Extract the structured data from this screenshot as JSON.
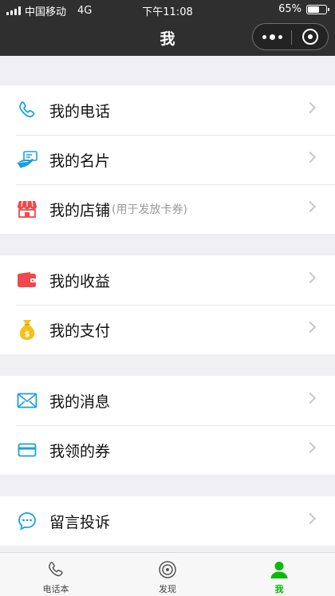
{
  "status_bar": {
    "carrier": "中国移动",
    "network": "4G",
    "time": "下午11:08",
    "battery": "65%",
    "battery_level": 0.65
  },
  "nav": {
    "title": "我"
  },
  "menu": {
    "group1": [
      {
        "label": "我的电话",
        "hint": "",
        "icon": "phone-icon"
      },
      {
        "label": "我的名片",
        "hint": "",
        "icon": "business-card-icon"
      },
      {
        "label": "我的店铺",
        "hint": "(用于发放卡券)",
        "icon": "store-icon"
      }
    ],
    "group2": [
      {
        "label": "我的收益",
        "hint": "",
        "icon": "wallet-icon"
      },
      {
        "label": "我的支付",
        "hint": "",
        "icon": "money-bag-icon"
      }
    ],
    "group3": [
      {
        "label": "我的消息",
        "hint": "",
        "icon": "envelope-icon"
      },
      {
        "label": "我领的券",
        "hint": "",
        "icon": "coupon-card-icon"
      }
    ],
    "group4": [
      {
        "label": "留言投诉",
        "hint": "",
        "icon": "chat-bubble-icon"
      }
    ]
  },
  "tabs": [
    {
      "label": "电话本",
      "icon": "phone-icon",
      "active": false
    },
    {
      "label": "发现",
      "icon": "compass-icon",
      "active": false
    },
    {
      "label": "我",
      "icon": "user-icon",
      "active": true
    }
  ],
  "colors": {
    "accent": "#09bb07",
    "icon_blue": "#1aa0dc",
    "icon_red": "#f0484b",
    "icon_yellow": "#f5c21a",
    "nav_bg": "#2f2f2f"
  }
}
